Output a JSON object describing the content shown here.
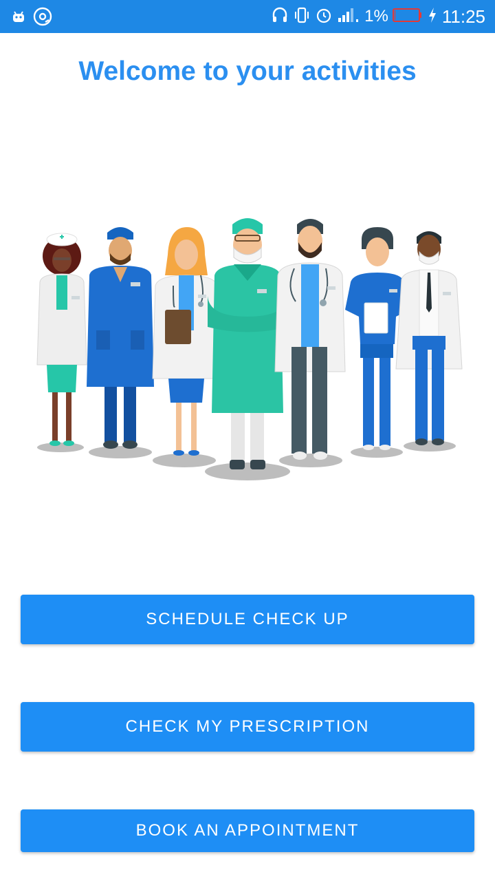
{
  "status_bar": {
    "battery_percent": "1%",
    "time": "11:25",
    "left_icons": [
      "android-icon",
      "sync-disc-icon"
    ],
    "right_icons": [
      "headphones-icon",
      "vibrate-icon",
      "alarm-icon",
      "signal-icon",
      "battery-icon",
      "charging-icon"
    ],
    "battery_level": 0.01,
    "colors": {
      "bar": "#1e88e5",
      "battery_low": "#e53935"
    }
  },
  "page": {
    "title": "Welcome to your activities"
  },
  "illustration": {
    "name": "medical-staff-illustration",
    "figures": [
      "nurse",
      "doctor",
      "female-doctor",
      "surgeon",
      "doctor",
      "nurse",
      "doctor"
    ]
  },
  "actions": {
    "schedule_label": "SCHEDULE CHECK UP",
    "prescription_label": "CHECK MY PRESCRIPTION",
    "appointment_label": "BOOK AN APPOINTMENT"
  },
  "colors": {
    "accent": "#1e8ef5",
    "title": "#2b8ff0"
  }
}
